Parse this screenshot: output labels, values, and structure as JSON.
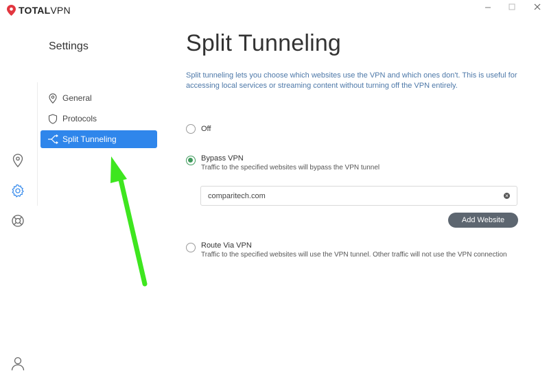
{
  "app": {
    "brand_bold": "TOTAL",
    "brand_light": "VPN",
    "window_controls": [
      "minimize",
      "maximize",
      "close"
    ]
  },
  "rail": {
    "items": [
      "location-icon",
      "gear-icon",
      "lifebuoy-icon"
    ],
    "bottom": "user-icon",
    "accent": "#2f86eb"
  },
  "settings": {
    "title": "Settings",
    "nav": [
      {
        "label": "General",
        "icon": "location-icon"
      },
      {
        "label": "Protocols",
        "icon": "shield-icon"
      },
      {
        "label": "Split Tunneling",
        "icon": "split-icon",
        "active": true
      }
    ]
  },
  "main": {
    "title": "Split Tunneling",
    "description": "Split tunneling lets you choose which websites use the VPN and which ones don't. This is useful for accessing local services or streaming content without turning off the VPN entirely.",
    "options": [
      {
        "label": "Off",
        "sub": "",
        "checked": false
      },
      {
        "label": "Bypass VPN",
        "sub": "Traffic to the specified websites will bypass the VPN tunnel",
        "checked": true
      },
      {
        "label": "Route Via VPN",
        "sub": "Traffic to the specified websites will use the VPN tunnel. Other traffic will not use the VPN connection",
        "checked": false
      }
    ],
    "website_input_value": "comparitech.com",
    "add_button_label": "Add Website"
  },
  "annotation": {
    "arrow_color": "#3ee61f"
  }
}
